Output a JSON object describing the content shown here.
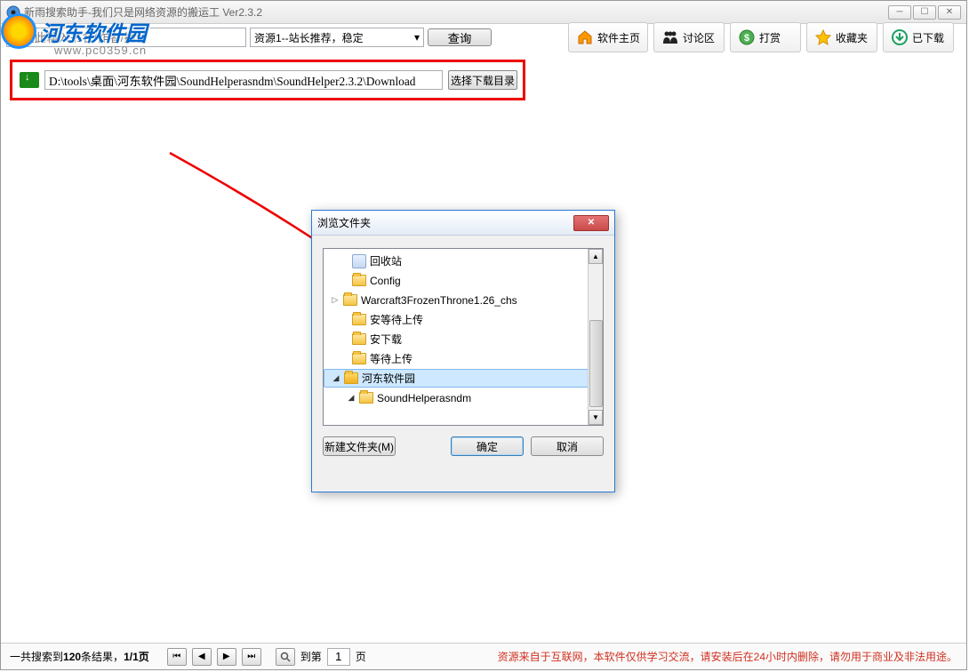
{
  "window": {
    "title": "新雨搜索助手-我们只是网络资源的搬运工 Ver2.3.2"
  },
  "toolbar": {
    "search_placeholder": "请在此输入书名/作者/播音",
    "source_selected": "资源1--站长推荐，稳定",
    "query_label": "查询"
  },
  "nav": {
    "home": "软件主页",
    "forum": "讨论区",
    "donate": "打赏",
    "favorites": "收藏夹",
    "downloaded": "已下载"
  },
  "download_path": {
    "value": "D:\\tools\\桌面\\河东软件园\\SoundHelperasndm\\SoundHelper2.3.2\\Download",
    "choose_label": "选择下载目录"
  },
  "watermark": {
    "text": "河东软件园",
    "url": "www.pc0359.cn"
  },
  "dialog": {
    "title": "浏览文件夹",
    "items": {
      "recycle": "回收站",
      "config": "Config",
      "warcraft": "Warcraft3FrozenThrone1.26_chs",
      "wait_upload1": "安等待上传",
      "download": "安下载",
      "wait_upload2": "等待上传",
      "hedong": "河东软件园",
      "soundhelper": "SoundHelperasndm"
    },
    "new_folder": "新建文件夹(M)",
    "ok": "确定",
    "cancel": "取消"
  },
  "status": {
    "results_prefix": "一共搜索到",
    "results_count": "120",
    "results_suffix": "条结果，",
    "page_info": "1/1页",
    "goto_prefix": "到第",
    "goto_value": "1",
    "goto_suffix": "页",
    "disclaimer": "资源来自于互联网，本软件仅供学习交流，请安装后在24小时内删除，请勿用于商业及非法用途。"
  }
}
